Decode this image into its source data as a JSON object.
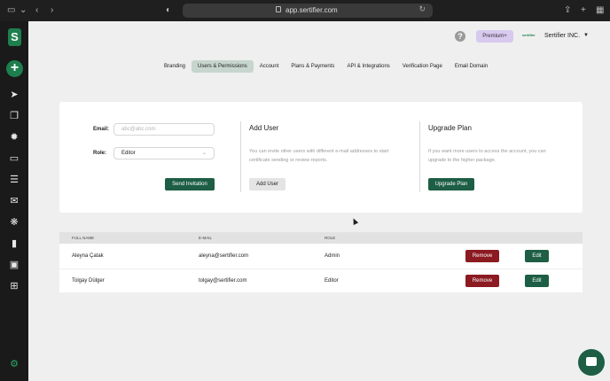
{
  "browser": {
    "url": "app.sertifier.com"
  },
  "header": {
    "help": "?",
    "premium_label": "Premium+",
    "mini_logo": "sertifier",
    "company_name": "Sertifier INC.",
    "dropdown_caret": "▼"
  },
  "tabs": [
    {
      "label": "Branding"
    },
    {
      "label": "Users & Permissions"
    },
    {
      "label": "Account"
    },
    {
      "label": "Plans & Payments"
    },
    {
      "label": "API & Integrations"
    },
    {
      "label": "Verification Page"
    },
    {
      "label": "Email Domain"
    }
  ],
  "invite": {
    "email_label": "Email:",
    "email_placeholder": "abc@abc.com",
    "role_label": "Role:",
    "role_value": "Editor",
    "send_label": "Send Invitation"
  },
  "add_user": {
    "title": "Add User",
    "text_line1": "You can invite other users with different e-mail addresses to start",
    "text_line2": "certificate sending or review reports.",
    "button_label": "Add User"
  },
  "upgrade": {
    "title": "Upgrade Plan",
    "text_line1": "If you want more users to access the account, you can",
    "text_line2": "upgrade to the higher package.",
    "button_label": "Upgrade Plan"
  },
  "table": {
    "headers": [
      "FULL NAME",
      "E-MAIL",
      "ROLE"
    ],
    "rows": [
      {
        "name": "Aleyna Çatak",
        "email": "aleyna@sertifier.com",
        "role": "Admin",
        "remove": "Remove",
        "edit": "Edit"
      },
      {
        "name": "Tolgay Dülger",
        "email": "tolgay@sertifier.com",
        "role": "Editor",
        "remove": "Remove",
        "edit": "Edit"
      }
    ]
  },
  "sidebar": {
    "logo": "S",
    "add": "+"
  },
  "colors": {
    "brand_green": "#1d5e45",
    "remove_red": "#8b1a21",
    "active_tab": "#c7d5cf",
    "premium_bg": "#d8c9ef"
  }
}
